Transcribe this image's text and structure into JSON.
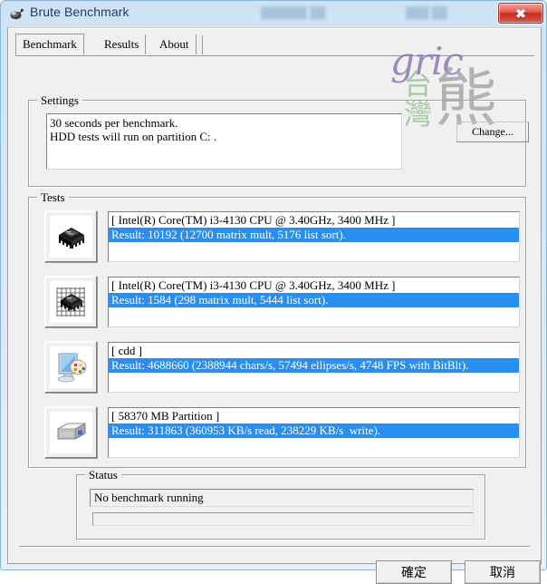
{
  "window": {
    "title": "Brute Benchmark",
    "title_icon": "app-mouse-icon",
    "close_label": "✖",
    "blurred_overlay_left": "██████ ██",
    "blurred_overlay_right": "███ ██"
  },
  "tabs": [
    {
      "label": "Benchmark",
      "active": true
    },
    {
      "label": "Results",
      "active": false
    },
    {
      "label": "About",
      "active": false
    }
  ],
  "watermark": {
    "script_text": "gric",
    "green_text": "台\n灣",
    "gray_text": "熊"
  },
  "settings": {
    "group_title": "Settings",
    "lines": [
      "30 seconds per benchmark.",
      "HDD tests will run on partition C: ."
    ],
    "change_button": "Change..."
  },
  "tests": {
    "group_title": "Tests",
    "rows": [
      {
        "icon": "cpu-chip-icon",
        "header": "[ Intel(R) Core(TM) i3-4130 CPU @ 3.40GHz, 3400 MHz ]",
        "result": "Result: 10192 (12700 matrix mult, 5176 list sort)."
      },
      {
        "icon": "fpu-chip-grid-icon",
        "header": "[ Intel(R) Core(TM) i3-4130 CPU @ 3.40GHz, 3400 MHz ]",
        "result": "Result: 1584 (298 matrix mult, 5444 list sort)."
      },
      {
        "icon": "graphics-monitor-palette-icon",
        "header": "[ cdd ]",
        "result": "Result: 4688660 (2388944 chars/s, 57494 ellipses/s, 4748 FPS with BitBlt)."
      },
      {
        "icon": "hard-drive-icon",
        "header": "[ 58370 MB Partition ]",
        "result": "Result: 311863 (360953 KB/s read, 238229 KB/s  write)."
      }
    ]
  },
  "status": {
    "group_title": "Status",
    "message": "No benchmark running",
    "progress_percent": 0
  },
  "footer": {
    "ok_label": "確定",
    "cancel_label": "取消"
  },
  "colors": {
    "selection_blue": "#2a8ef0",
    "titlebar_blue": "#cfe3f5",
    "close_red": "#c62a20",
    "dialog_face": "#f0f0f0"
  }
}
